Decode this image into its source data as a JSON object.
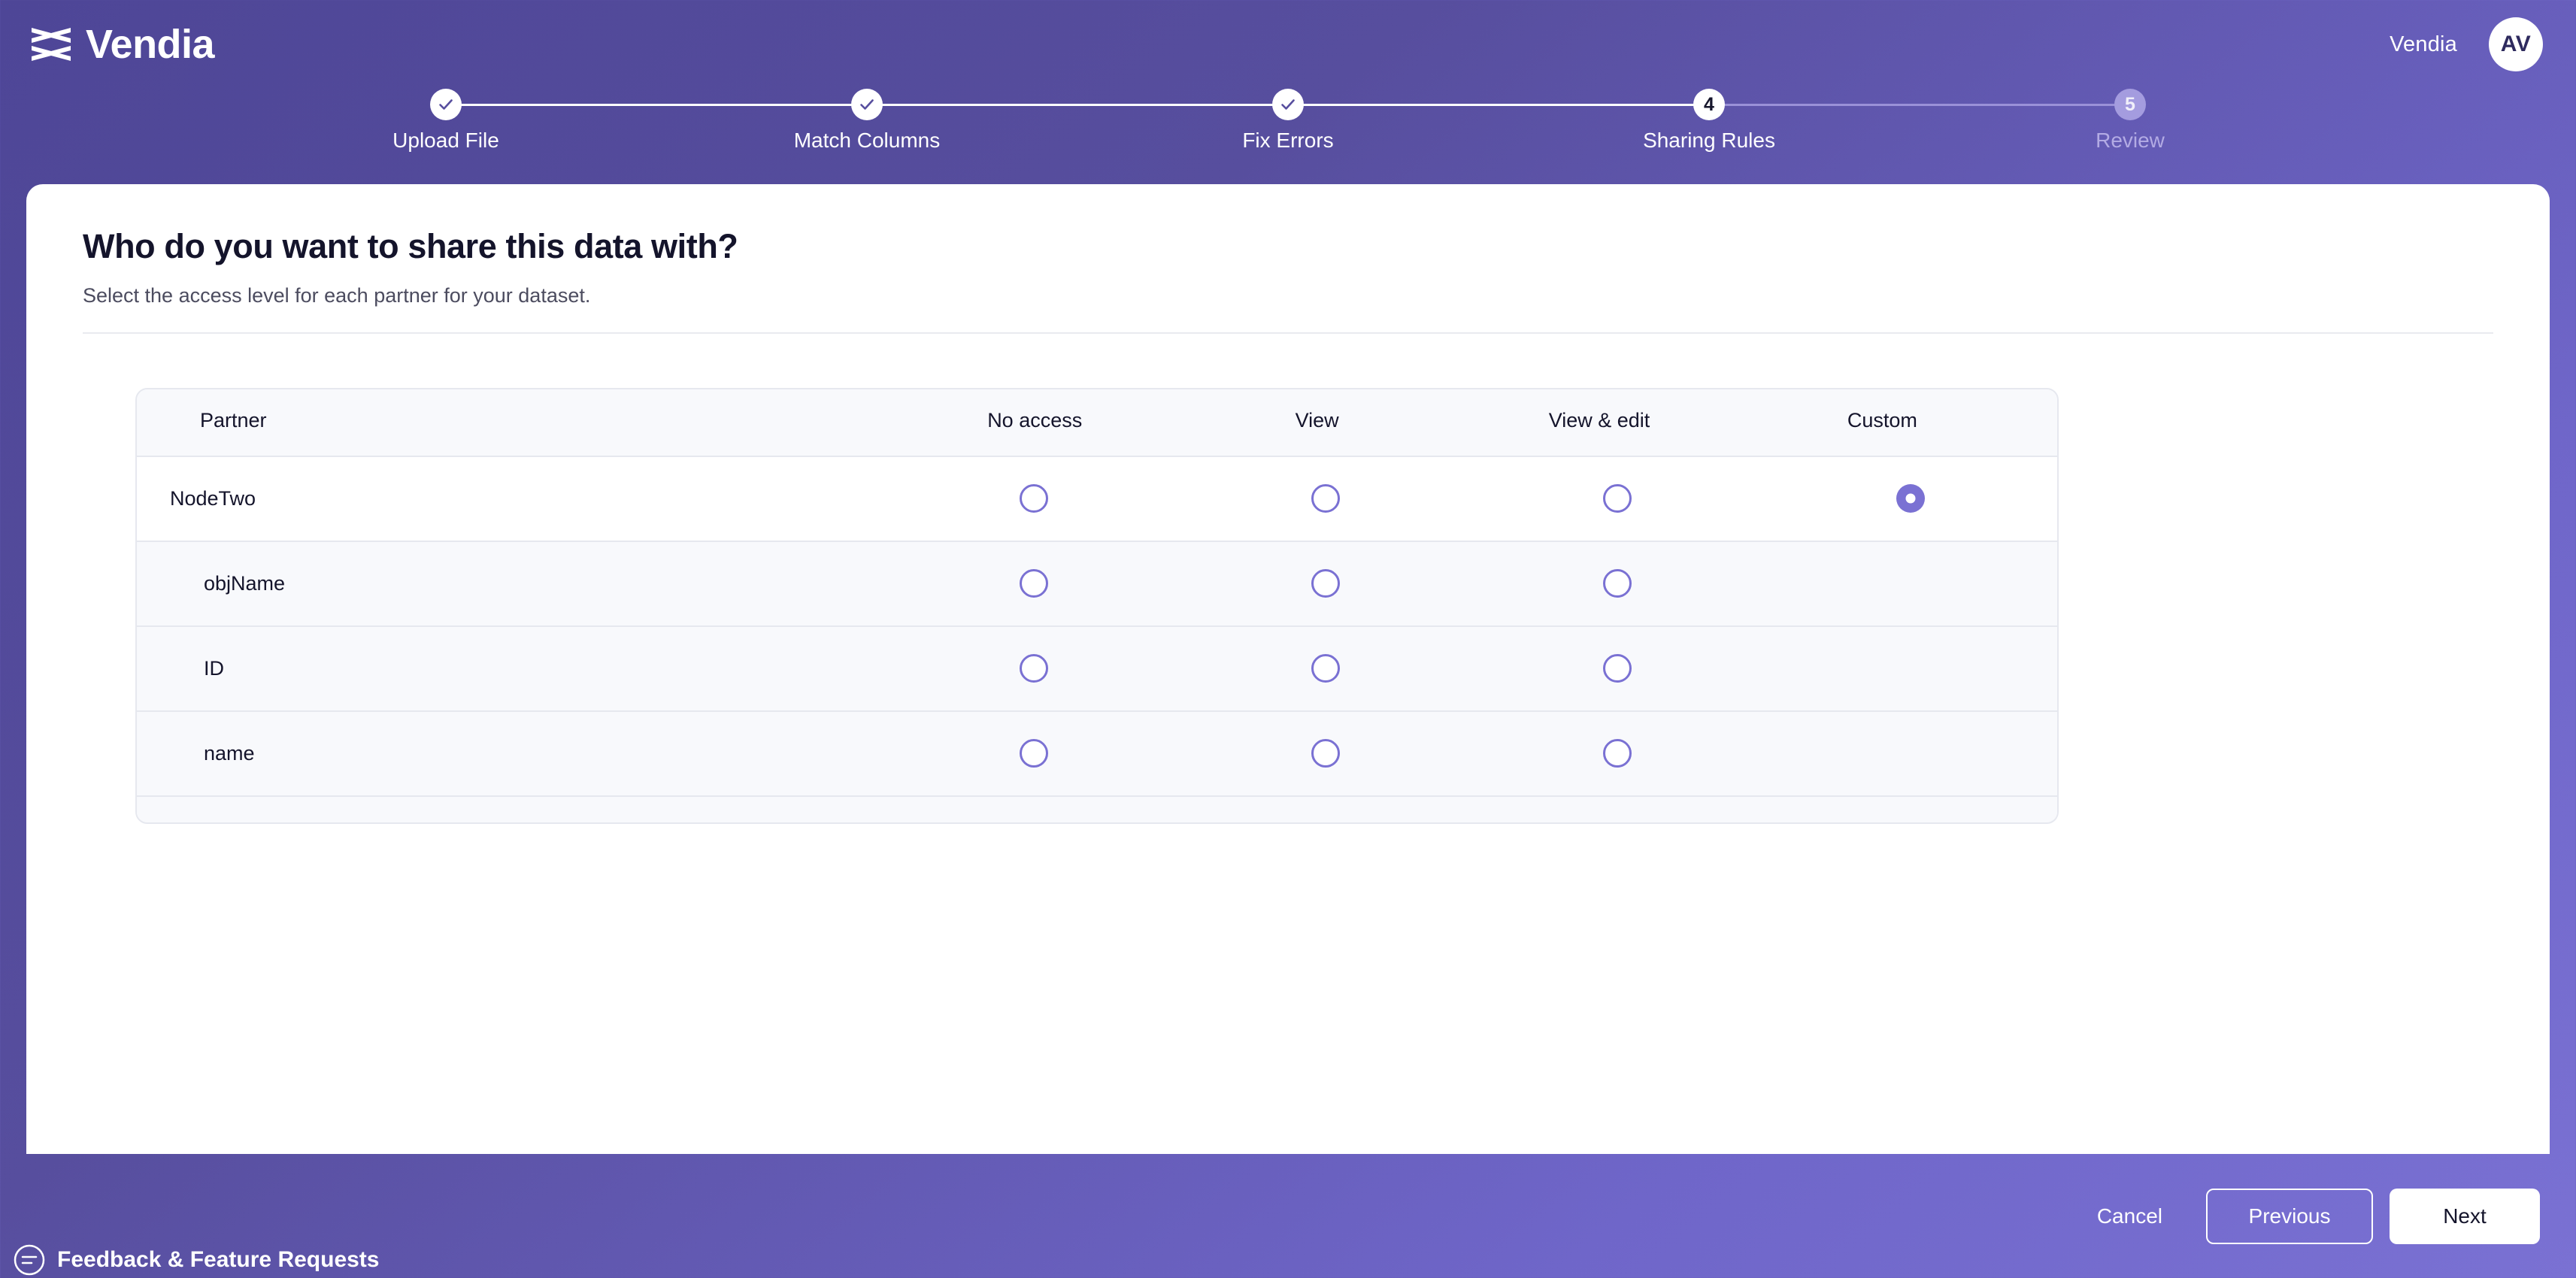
{
  "header": {
    "brand_name": "Vendia",
    "brand_logo_icon": "vendia-hourglass-logo",
    "org_name": "Vendia",
    "avatar_initials": "AV"
  },
  "stepper": {
    "steps": [
      {
        "number": "1",
        "label": "Upload File",
        "state": "done"
      },
      {
        "number": "2",
        "label": "Match Columns",
        "state": "done"
      },
      {
        "number": "3",
        "label": "Fix Errors",
        "state": "done"
      },
      {
        "number": "4",
        "label": "Sharing Rules",
        "state": "active"
      },
      {
        "number": "5",
        "label": "Review",
        "state": "upcoming"
      }
    ]
  },
  "main": {
    "title": "Who do you want to share this data with?",
    "subtitle": "Select the access level for each partner for your dataset.",
    "table": {
      "columns": [
        "Partner",
        "No access",
        "View",
        "View & edit",
        "Custom"
      ],
      "rows": [
        {
          "label": "NodeTwo",
          "type": "partner",
          "selected": "Custom"
        },
        {
          "label": "objName",
          "type": "child",
          "selected": ""
        },
        {
          "label": "ID",
          "type": "child",
          "selected": ""
        },
        {
          "label": "name",
          "type": "child",
          "selected": ""
        }
      ]
    }
  },
  "footer": {
    "cancel_label": "Cancel",
    "previous_label": "Previous",
    "next_label": "Next"
  },
  "feedback": {
    "label": "Feedback & Feature Requests",
    "icon": "feedback-circle-icon"
  },
  "colors": {
    "brand_purple": "#574e9e",
    "accent_purple": "#7a71d3",
    "muted_step": "#a49cdf",
    "card_bg": "#ffffff",
    "row_alt_bg": "#f8f9fc",
    "border": "#e6e8ef"
  }
}
